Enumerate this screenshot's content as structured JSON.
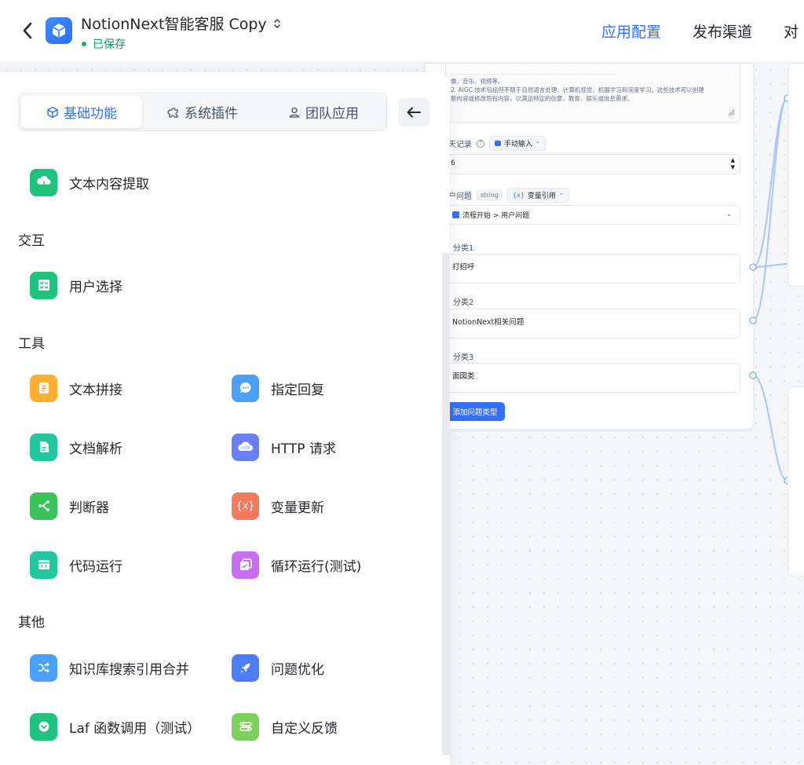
{
  "header": {
    "app_title": "NotionNext智能客服 Copy",
    "save_status": "已保存",
    "tabs": [
      "应用配置",
      "发布渠道",
      "对"
    ]
  },
  "canvas_node": {
    "prompt_lines": [
      "........................................................................................",
      "像、音乐、视频等。",
      "2. AIGC 技术包括但不限于自然语言处理、计算机视觉、机器学习和深度学习。这些技术可以创建",
      "新内容或修改现有内容，以满足特定的创意、教育、娱乐或信息需求。"
    ],
    "history_label": "天记录",
    "history_mode": "手动输入",
    "history_value": "6",
    "question_label": "户问题",
    "question_type": "string",
    "question_mode": "变量引用",
    "question_ref": "流程开始 > 用户问题",
    "classes": [
      {
        "label": "分类1",
        "value": "打招呼"
      },
      {
        "label": "分类2",
        "value": "NotionNext相关问题"
      },
      {
        "label": "分类3",
        "value": "面図类"
      }
    ],
    "add_type_label": "添加问题类型"
  },
  "panel": {
    "tabs": [
      {
        "label": "基础功能",
        "icon": "cube-icon",
        "active": true
      },
      {
        "label": "系统插件",
        "icon": "puzzle-icon",
        "active": false
      },
      {
        "label": "团队应用",
        "icon": "user-icon",
        "active": false
      }
    ],
    "top_module": {
      "label": "文本内容提取",
      "icon": "cloud-extract-icon",
      "color": "#1fc37d"
    },
    "sections": [
      {
        "title": "交互",
        "modules": [
          {
            "label": "用户选择",
            "icon": "checklist-icon",
            "color": "#1fc37d"
          }
        ]
      },
      {
        "title": "工具",
        "modules": [
          {
            "label": "文本拼接",
            "icon": "text-doc-icon",
            "color": "#fbb034"
          },
          {
            "label": "指定回复",
            "icon": "chat-bubble-icon",
            "color": "#4aa0f7"
          },
          {
            "label": "文档解析",
            "icon": "file-icon",
            "color": "#22c7a0"
          },
          {
            "label": "HTTP 请求",
            "icon": "http-cloud-icon",
            "color": "#6a7ef5"
          },
          {
            "label": "判断器",
            "icon": "branch-icon",
            "color": "#3bc35e"
          },
          {
            "label": "变量更新",
            "icon": "variable-icon",
            "color": "#f5795b"
          },
          {
            "label": "代码运行",
            "icon": "code-window-icon",
            "color": "#22c7a0"
          },
          {
            "label": "循环运行(测试)",
            "icon": "loop-check-icon",
            "color": "#c86ef0"
          }
        ]
      },
      {
        "title": "其他",
        "modules": [
          {
            "label": "知识库搜索引用合并",
            "icon": "merge-icon",
            "color": "#4aa0f7"
          },
          {
            "label": "问题优化",
            "icon": "rocket-icon",
            "color": "#4b7ef6"
          },
          {
            "label": "Laf 函数调用（测试）",
            "icon": "laf-icon",
            "color": "#1fc37d"
          },
          {
            "label": "自定义反馈",
            "icon": "sliders-icon",
            "color": "#7dcf5e"
          }
        ]
      }
    ]
  }
}
